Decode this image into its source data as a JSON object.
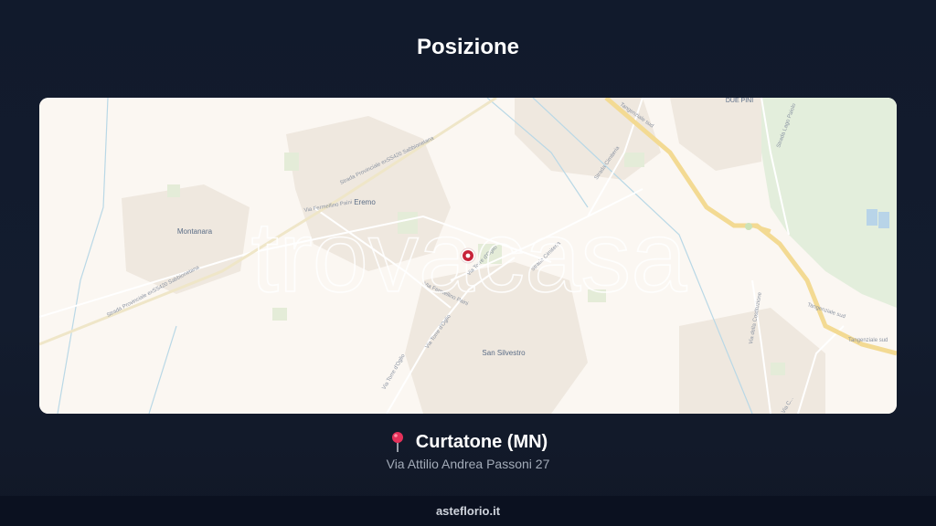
{
  "page": {
    "title": "Posizione"
  },
  "map": {
    "watermark": "trovacasa",
    "places": {
      "montanara": "Montanara",
      "eremo": "Eremo",
      "san_silvestro": "San Silvestro",
      "due_pini": "DUE PINI"
    },
    "roads": {
      "sp_upper": "Strada Provinciale exSS420 Sabbionetana",
      "sp_lower": "Strada Provinciale exSS420 Sabbionetana",
      "fermi": "Via Fermellino Paini",
      "fermi2": "Via Fermellino Paini",
      "torre1": "Via Torre d'Oglio",
      "torre2": "Via Torre d'Oglio",
      "torre3": "Via Torre d'Oglio",
      "cimitero1": "Strada Cimiteria",
      "cimitero2": "Strada Cimiteria",
      "tangenziale1": "Tangenziale sud",
      "tangenziale2": "Tangenziale sud",
      "tangenziale3": "Tangenziale sud",
      "lago_paiolo": "Strada Lago Paiolo",
      "costituzione": "Via della Costituzione",
      "cavalli": "Via C..."
    },
    "marker_icon": "location-marker-icon"
  },
  "location": {
    "pin_icon": "pushpin-icon",
    "city": "Curtatone (MN)",
    "address": "Via Attilio Andrea Passoni 27"
  },
  "footer": {
    "site": "asteflorio.it"
  }
}
